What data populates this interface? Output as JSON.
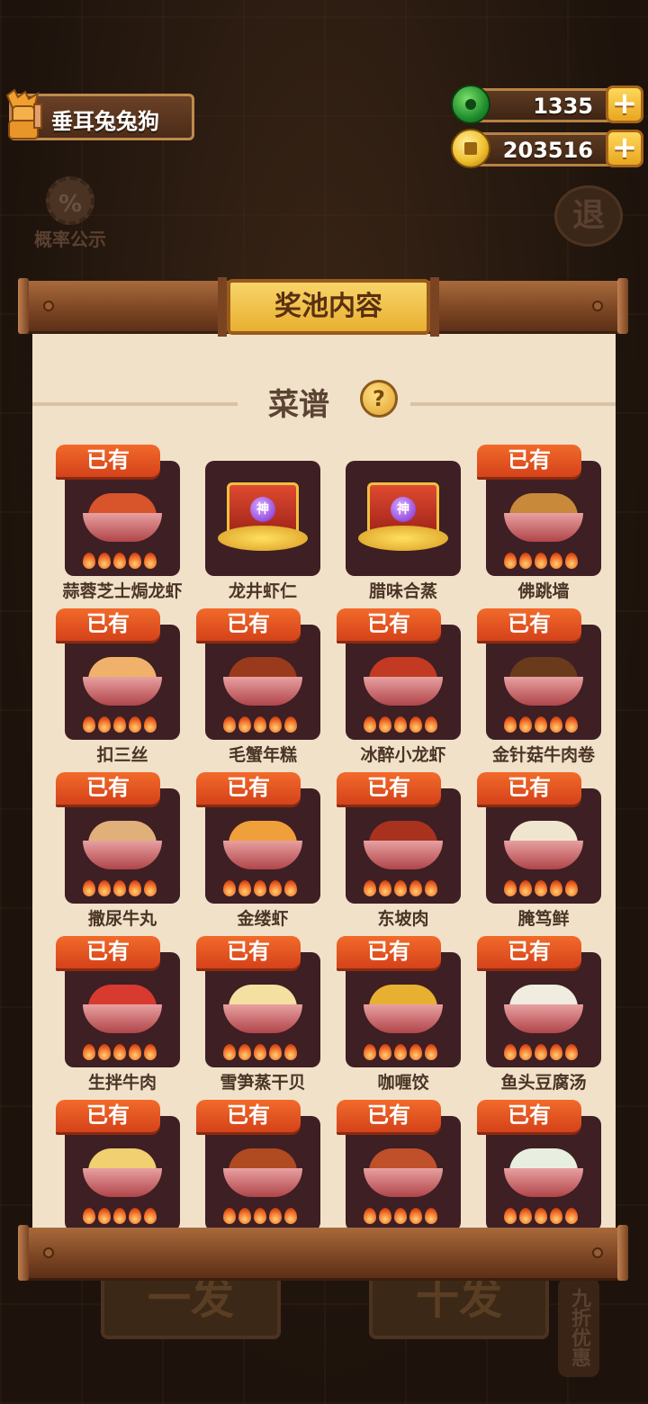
{
  "player": {
    "name": "垂耳兔兔狗"
  },
  "resources": {
    "jade": "1335",
    "coins": "203516",
    "plus": "+"
  },
  "top_buttons": {
    "probability": "概率公示",
    "probability_icon": "%",
    "exit": "退"
  },
  "panel": {
    "title": "奖池内容",
    "section_title": "菜谱",
    "help": "?"
  },
  "owned_label": "已有",
  "recipes": [
    {
      "name": "蒜蓉芝士焗龙虾",
      "owned": true,
      "locked": false,
      "food": "#d8542a"
    },
    {
      "name": "龙井虾仁",
      "owned": false,
      "locked": true,
      "orb": "神"
    },
    {
      "name": "腊味合蒸",
      "owned": false,
      "locked": true,
      "orb": "神"
    },
    {
      "name": "佛跳墙",
      "owned": true,
      "locked": false,
      "food": "#c8893a"
    },
    {
      "name": "扣三丝",
      "owned": true,
      "locked": false,
      "food": "#f0b26a"
    },
    {
      "name": "毛蟹年糕",
      "owned": true,
      "locked": false,
      "food": "#9a3a1c"
    },
    {
      "name": "冰醉小龙虾",
      "owned": true,
      "locked": false,
      "food": "#c23a22"
    },
    {
      "name": "金针菇牛肉卷",
      "owned": true,
      "locked": false,
      "food": "#6a3a1c"
    },
    {
      "name": "撒尿牛丸",
      "owned": true,
      "locked": false,
      "food": "#e0b07a"
    },
    {
      "name": "金缕虾",
      "owned": true,
      "locked": false,
      "food": "#f0a03a"
    },
    {
      "name": "东坡肉",
      "owned": true,
      "locked": false,
      "food": "#a8321e"
    },
    {
      "name": "腌笃鲜",
      "owned": true,
      "locked": false,
      "food": "#f0e6d0"
    },
    {
      "name": "生拌牛肉",
      "owned": true,
      "locked": false,
      "food": "#d83a30"
    },
    {
      "name": "雪笋蒸干贝",
      "owned": true,
      "locked": false,
      "food": "#f4e0a0"
    },
    {
      "name": "咖喱饺",
      "owned": true,
      "locked": false,
      "food": "#e8b030"
    },
    {
      "name": "鱼头豆腐汤",
      "owned": true,
      "locked": false,
      "food": "#f0ece0"
    },
    {
      "name": "",
      "owned": true,
      "locked": false,
      "food": "#f0d070"
    },
    {
      "name": "",
      "owned": true,
      "locked": false,
      "food": "#b04a20"
    },
    {
      "name": "",
      "owned": true,
      "locked": false,
      "food": "#c0502a"
    },
    {
      "name": "",
      "owned": true,
      "locked": false,
      "food": "#e8efe0"
    }
  ],
  "bottom": {
    "single": "一发",
    "ten": "十发",
    "discount": "九折优惠"
  }
}
